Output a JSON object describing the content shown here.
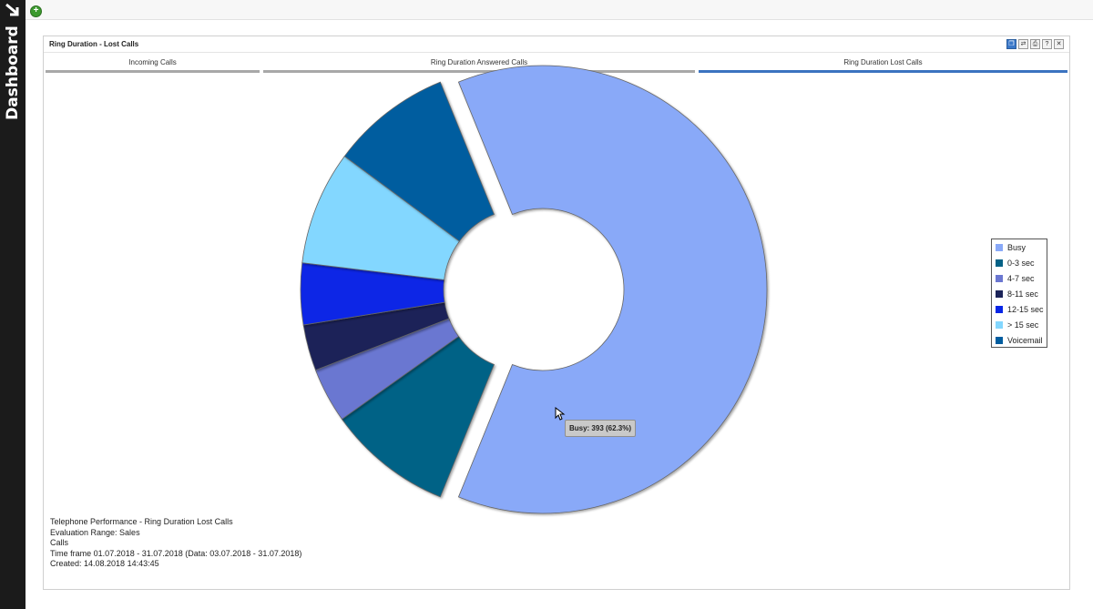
{
  "sidebar": {
    "title": "Dashboard"
  },
  "panel": {
    "title": "Ring Duration - Lost Calls",
    "tools": [
      "copy-icon",
      "refresh-icon",
      "print-icon",
      "help-icon",
      "close-icon"
    ],
    "tool_glyphs": [
      "❐",
      "⇄",
      "⎙",
      "?",
      "✕"
    ]
  },
  "tabs": [
    {
      "label": "Incoming Calls",
      "active": false
    },
    {
      "label": "Ring Duration Answered Calls",
      "active": false
    },
    {
      "label": "Ring Duration Lost Calls",
      "active": true
    }
  ],
  "chart_data": {
    "type": "pie",
    "donut": true,
    "total": 631,
    "slices": [
      {
        "name": "Busy",
        "value": 393,
        "percent": 62.3,
        "color": "#89a9f8",
        "exploded": true
      },
      {
        "name": "0-3 sec",
        "value": 57,
        "color": "#046286"
      },
      {
        "name": "4-7 sec",
        "value": 25,
        "color": "#6b77d1"
      },
      {
        "name": "8-11 sec",
        "value": 21,
        "color": "#1c2459"
      },
      {
        "name": "12-15 sec",
        "value": 28,
        "color": "#0826e6"
      },
      {
        "name": "> 15 sec",
        "value": 52,
        "color": "#83d7ff"
      },
      {
        "name": "Voicemail",
        "value": 55,
        "color": "#015d9f"
      }
    ],
    "legend_position": "right",
    "tooltip": "Busy: 393 (62.3%)"
  },
  "info_lines": [
    "Telephone Performance - Ring Duration Lost Calls",
    "Evaluation Range: Sales",
    "Calls",
    "Time frame 01.07.2018 - 31.07.2018 (Data: 03.07.2018 - 31.07.2018)",
    "Created: 14.08.2018 14:43:45"
  ]
}
